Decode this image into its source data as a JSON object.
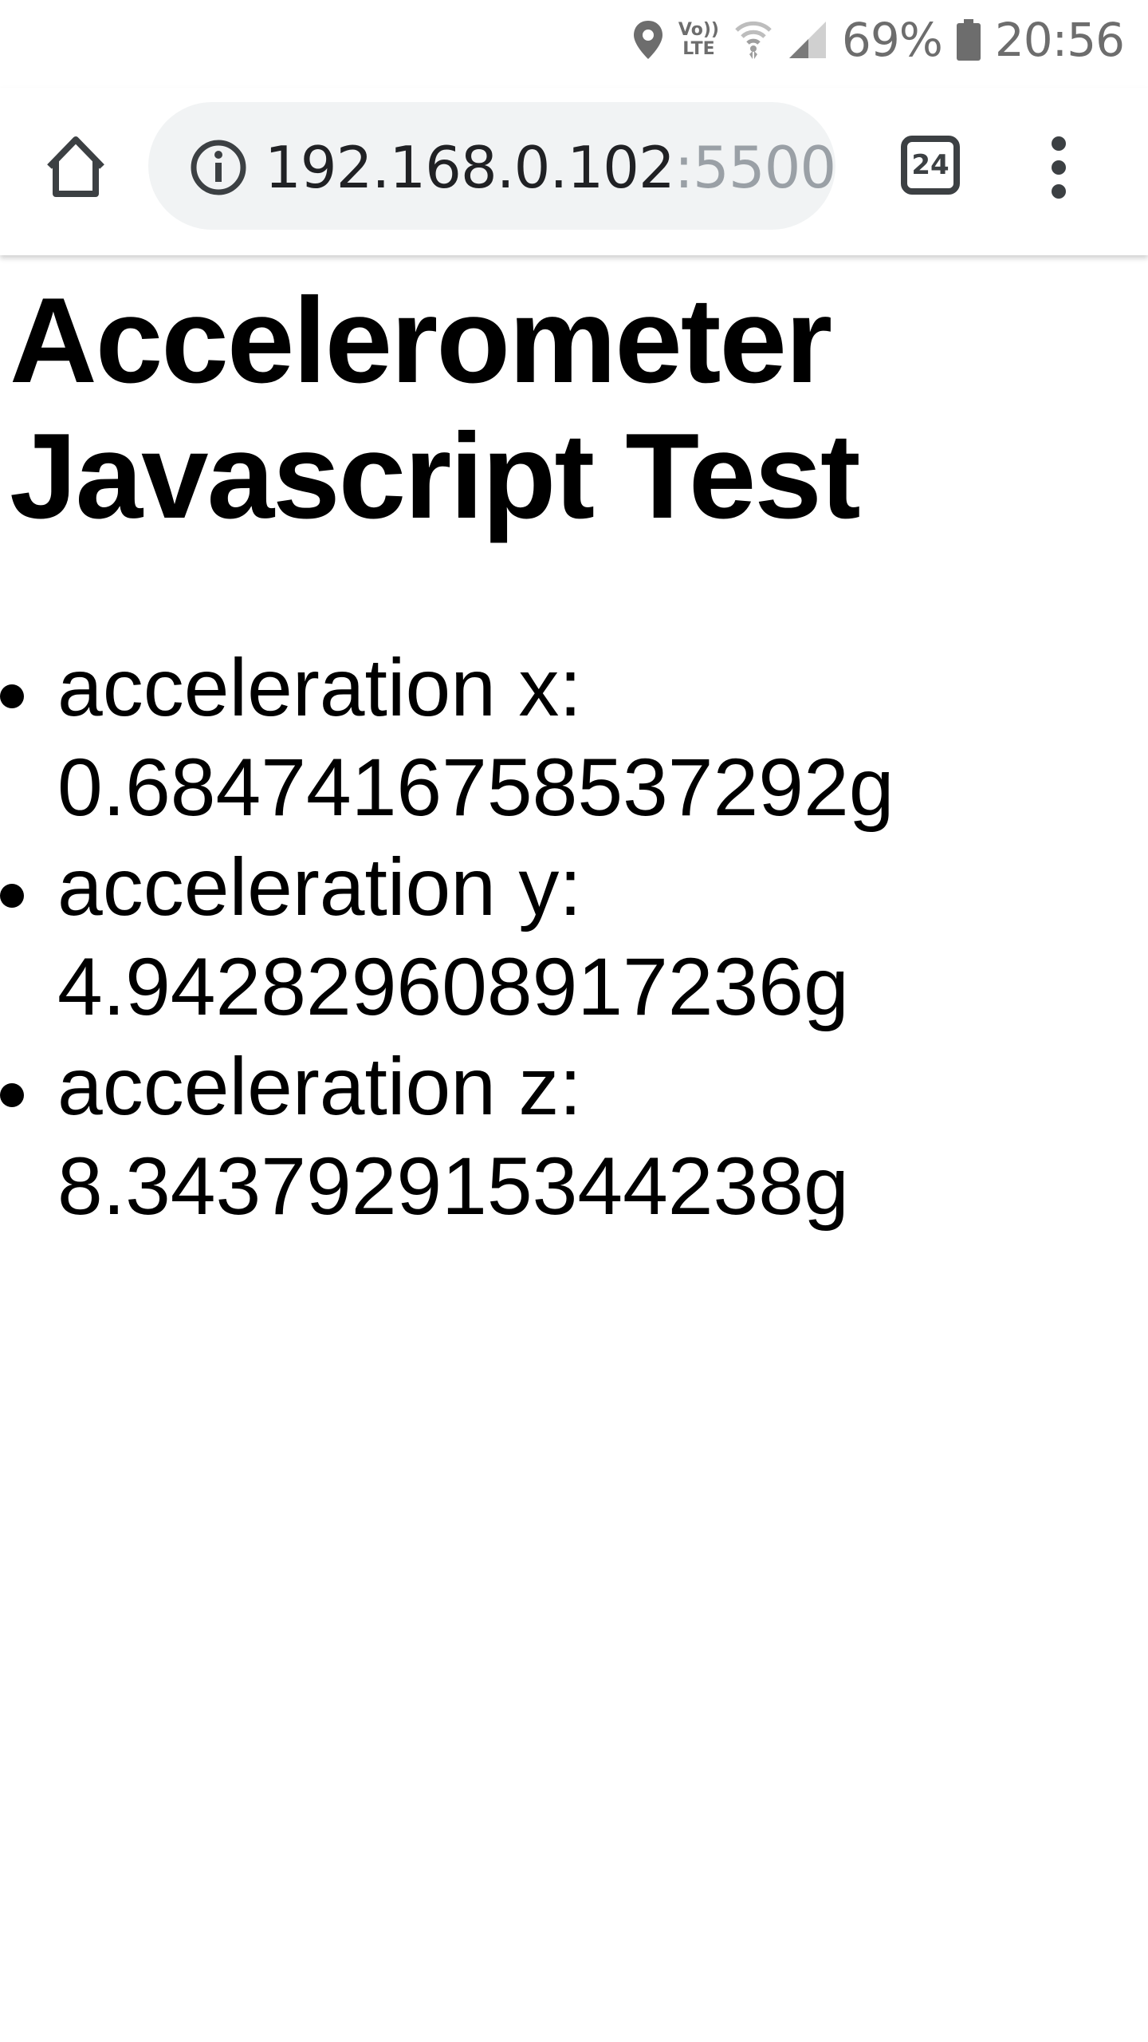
{
  "status_bar": {
    "battery_percent": "69%",
    "time": "20:56",
    "volte_label_top": "Vo))",
    "volte_label_bottom": "LTE",
    "icons": [
      "location-icon",
      "volte-icon",
      "wifi-icon",
      "signal-icon",
      "battery-icon"
    ]
  },
  "toolbar": {
    "url_host": "192.168.0.102",
    "url_port": ":5500",
    "tab_count": "24",
    "icons": [
      "home-icon",
      "info-icon",
      "tabs-icon",
      "more-vert-icon"
    ]
  },
  "page": {
    "title": "Accelerometer Javascript Test",
    "items": [
      {
        "label": "acceleration x:",
        "value": "0.6847416758537292g"
      },
      {
        "label": "acceleration y:",
        "value": "4.942829608917236g"
      },
      {
        "label": "acceleration z:",
        "value": "8.343792915344238g"
      }
    ]
  }
}
